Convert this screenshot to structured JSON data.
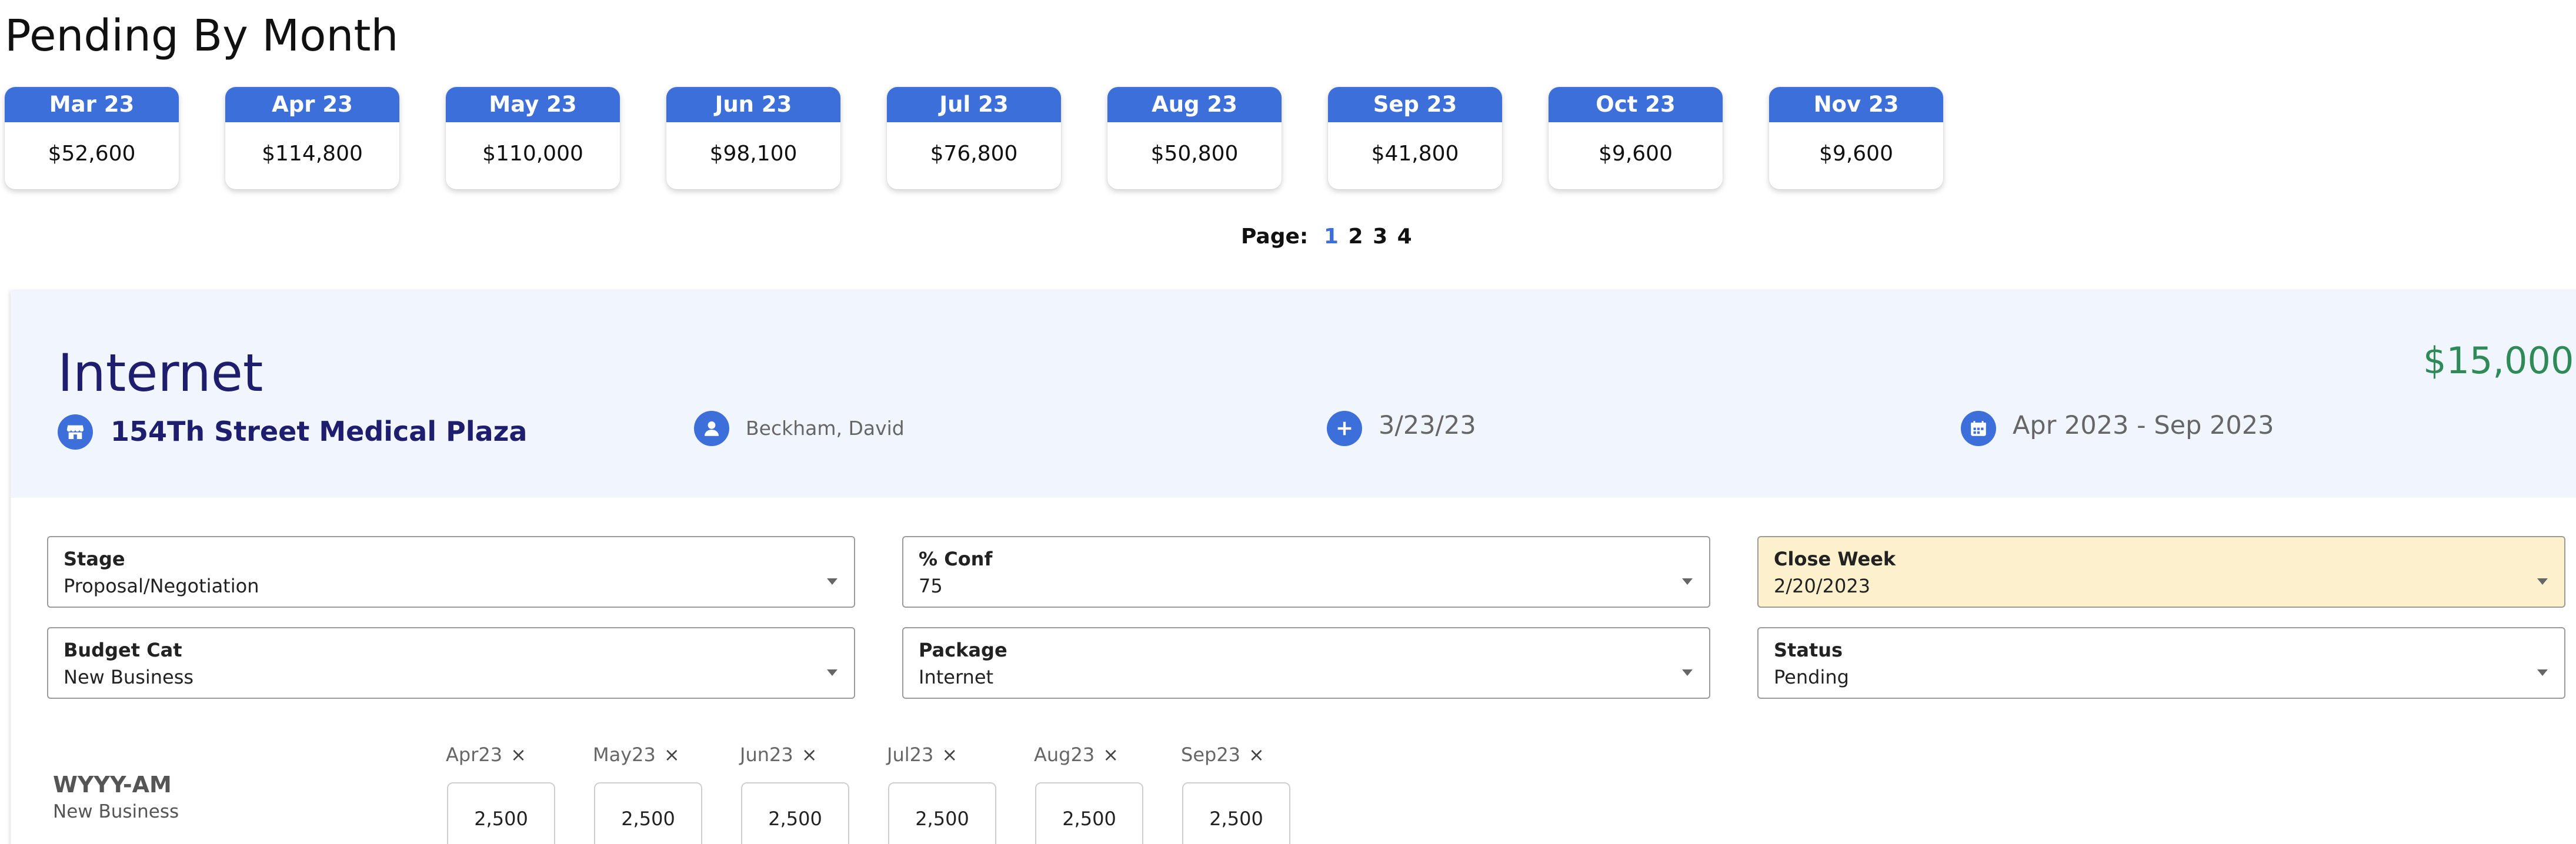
{
  "title": "Pending By Month",
  "months": [
    {
      "label": "Mar 23",
      "value": "$52,600"
    },
    {
      "label": "Apr 23",
      "value": "$114,800"
    },
    {
      "label": "May 23",
      "value": "$110,000"
    },
    {
      "label": "Jun 23",
      "value": "$98,100"
    },
    {
      "label": "Jul 23",
      "value": "$76,800"
    },
    {
      "label": "Aug 23",
      "value": "$50,800"
    },
    {
      "label": "Sep 23",
      "value": "$41,800"
    },
    {
      "label": "Oct 23",
      "value": "$9,600"
    },
    {
      "label": "Nov 23",
      "value": "$9,600"
    }
  ],
  "pager": {
    "label": "Page:",
    "pages": [
      "1",
      "2",
      "3",
      "4"
    ],
    "active": "1"
  },
  "deal": {
    "product": "Internet",
    "amount": "$15,000",
    "account": "154Th Street Medical Plaza",
    "owner": "Beckham, David",
    "created": "3/23/23",
    "range": "Apr 2023 - Sep 2023"
  },
  "fields": [
    {
      "label": "Stage",
      "value": "Proposal/Negotiation"
    },
    {
      "label": "% Conf",
      "value": "75"
    },
    {
      "label": "Close Week",
      "value": "2/20/2023"
    },
    {
      "label": "Budget Cat",
      "value": "New Business"
    },
    {
      "label": "Package",
      "value": "Internet"
    },
    {
      "label": "Status",
      "value": "Pending"
    }
  ],
  "station": {
    "name": "WYYY-AM",
    "category": "New Business"
  },
  "allocations": [
    {
      "month": "Apr23",
      "value": "2,500"
    },
    {
      "month": "May23",
      "value": "2,500"
    },
    {
      "month": "Jun23",
      "value": "2,500"
    },
    {
      "month": "Jul23",
      "value": "2,500"
    },
    {
      "month": "Aug23",
      "value": "2,500"
    },
    {
      "month": "Sep23",
      "value": "2,500"
    }
  ],
  "remove_glyph": "×",
  "colors": {
    "accent": "#3d6fdb",
    "amount": "#2e8b57",
    "highlight": "#fcf0cd",
    "navy": "#1f1e6e"
  },
  "icons": [
    "store-icon",
    "user-icon",
    "plus-icon",
    "calendar-icon",
    "chevron-down-icon",
    "close-icon"
  ]
}
